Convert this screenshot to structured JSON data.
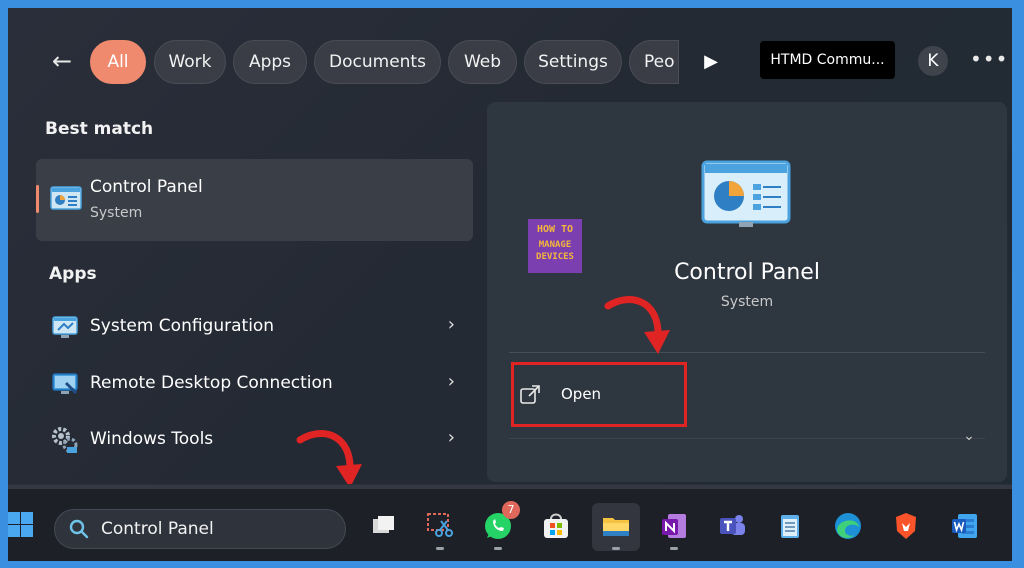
{
  "filters": {
    "tabs": [
      {
        "label": "All",
        "active": true
      },
      {
        "label": "Work"
      },
      {
        "label": "Apps"
      },
      {
        "label": "Documents"
      },
      {
        "label": "Web"
      },
      {
        "label": "Settings"
      },
      {
        "label": "Peo"
      }
    ],
    "org_label": "HTMD Commu...",
    "avatar_initial": "K"
  },
  "best_match": {
    "heading": "Best match",
    "title": "Control Panel",
    "subtitle": "System"
  },
  "apps": {
    "heading": "Apps",
    "items": [
      {
        "label": "System Configuration",
        "icon": "msconfig-icon"
      },
      {
        "label": "Remote Desktop Connection",
        "icon": "remote-desktop-icon"
      },
      {
        "label": "Windows Tools",
        "icon": "windows-tools-icon"
      }
    ]
  },
  "detail": {
    "title": "Control Panel",
    "subtitle": "System",
    "open_label": "Open"
  },
  "logo": {
    "line1": "HOW TO",
    "line2": "MANAGE",
    "line3": "DEVICES"
  },
  "taskbar": {
    "search_value": "Control Panel",
    "whatsapp_badge": "7",
    "apps": [
      "task-view-icon",
      "snipping-tool-icon",
      "whatsapp-icon",
      "microsoft-store-icon",
      "file-explorer-icon",
      "onenote-icon",
      "teams-icon",
      "notepad-icon",
      "edge-icon",
      "brave-icon",
      "word-icon"
    ]
  },
  "colors": {
    "accent": "#f08a6e",
    "highlight": "#e02424",
    "frame": "#3b8fe0"
  }
}
